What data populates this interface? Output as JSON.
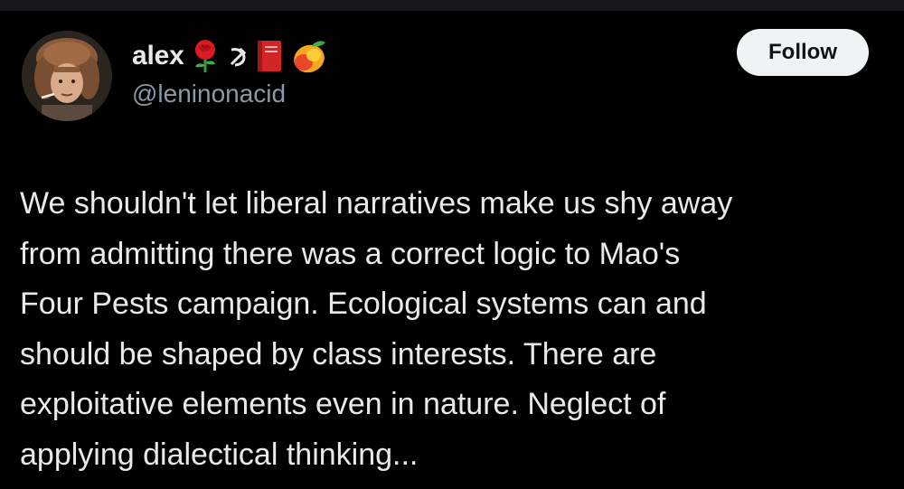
{
  "author": {
    "display_name": "alex",
    "handle": "@leninonacid",
    "name_emojis": [
      "rose-icon",
      "hammer-sickle-icon",
      "red-book-icon",
      "mango-icon"
    ]
  },
  "actions": {
    "follow_label": "Follow"
  },
  "tweet": {
    "lines": [
      "We shouldn't let liberal narratives make us shy away",
      "from admitting there was a correct logic to Mao's",
      "Four Pests campaign. Ecological systems can and",
      "should be shaped by class interests. There are",
      "exploitative elements even in nature. Neglect of",
      "applying dialectical thinking..."
    ]
  },
  "colors": {
    "background": "#000000",
    "text_primary": "#e7e9ea",
    "text_secondary": "#8b98a5",
    "button_bg": "#eff3f4",
    "button_text": "#0f1419"
  }
}
